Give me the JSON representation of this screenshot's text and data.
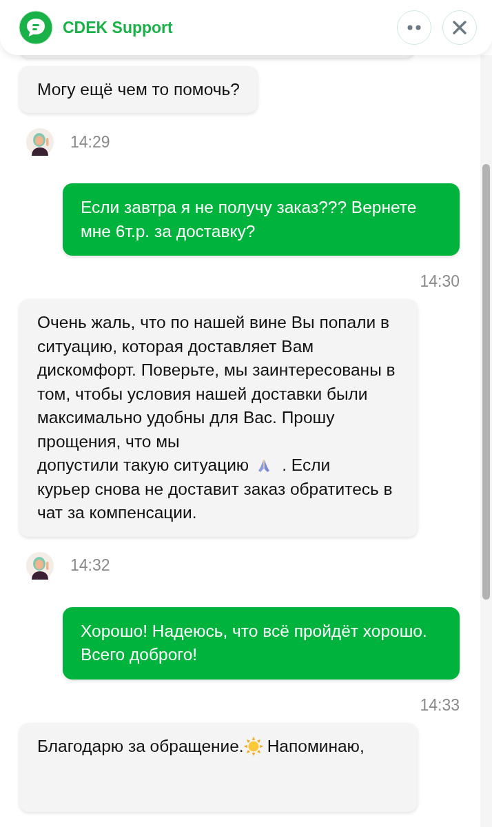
{
  "header": {
    "title": "CDEK Support"
  },
  "messages": [
    {
      "kind": "agent"
    },
    {
      "kind": "agent",
      "parts": [
        {
          "kind": "text",
          "text": "Могу ещё чем то помочь?"
        }
      ]
    },
    {
      "kind": "agent_meta",
      "time": "14:29"
    },
    {
      "kind": "user",
      "parts": [
        {
          "kind": "text",
          "text": "Если завтра я не получу заказ??? Вернете мне 6т.р. за доставку?"
        }
      ]
    },
    {
      "kind": "user_time",
      "time": "14:30"
    },
    {
      "kind": "agent",
      "parts": [
        {
          "kind": "text",
          "text": "Очень жаль, что по нашей вине Вы попали в ситуацию, которая доставляет Вам дискомфорт. Поверьте, мы заинтересованы в том, чтобы условия нашей доставки были максимально удобны для Вас. Прошу прощения, что мы"
        },
        {
          "kind": "line",
          "segments": [
            {
              "kind": "text",
              "text": "допустили такую ситуацию"
            },
            {
              "kind": "praying_hands"
            },
            {
              "kind": "text",
              "text": ". Если"
            }
          ]
        },
        {
          "kind": "text",
          "text": "курьер снова не доставит заказ обратитесь в чат за компенсации."
        }
      ]
    },
    {
      "kind": "agent_meta",
      "time": "14:32"
    },
    {
      "kind": "user",
      "parts": [
        {
          "kind": "text",
          "text": "Хорошо! Надеюсь, что всё пройдёт хорошо. Всего доброго!"
        }
      ]
    },
    {
      "kind": "user_time",
      "time": "14:33"
    },
    {
      "kind": "agent",
      "parts": [
        {
          "kind": "line",
          "segments": [
            {
              "kind": "text",
              "text": "Благодарю за обращение."
            },
            {
              "kind": "sun"
            },
            {
              "kind": "text",
              "text": "Напоминаю,"
            }
          ]
        }
      ]
    }
  ]
}
